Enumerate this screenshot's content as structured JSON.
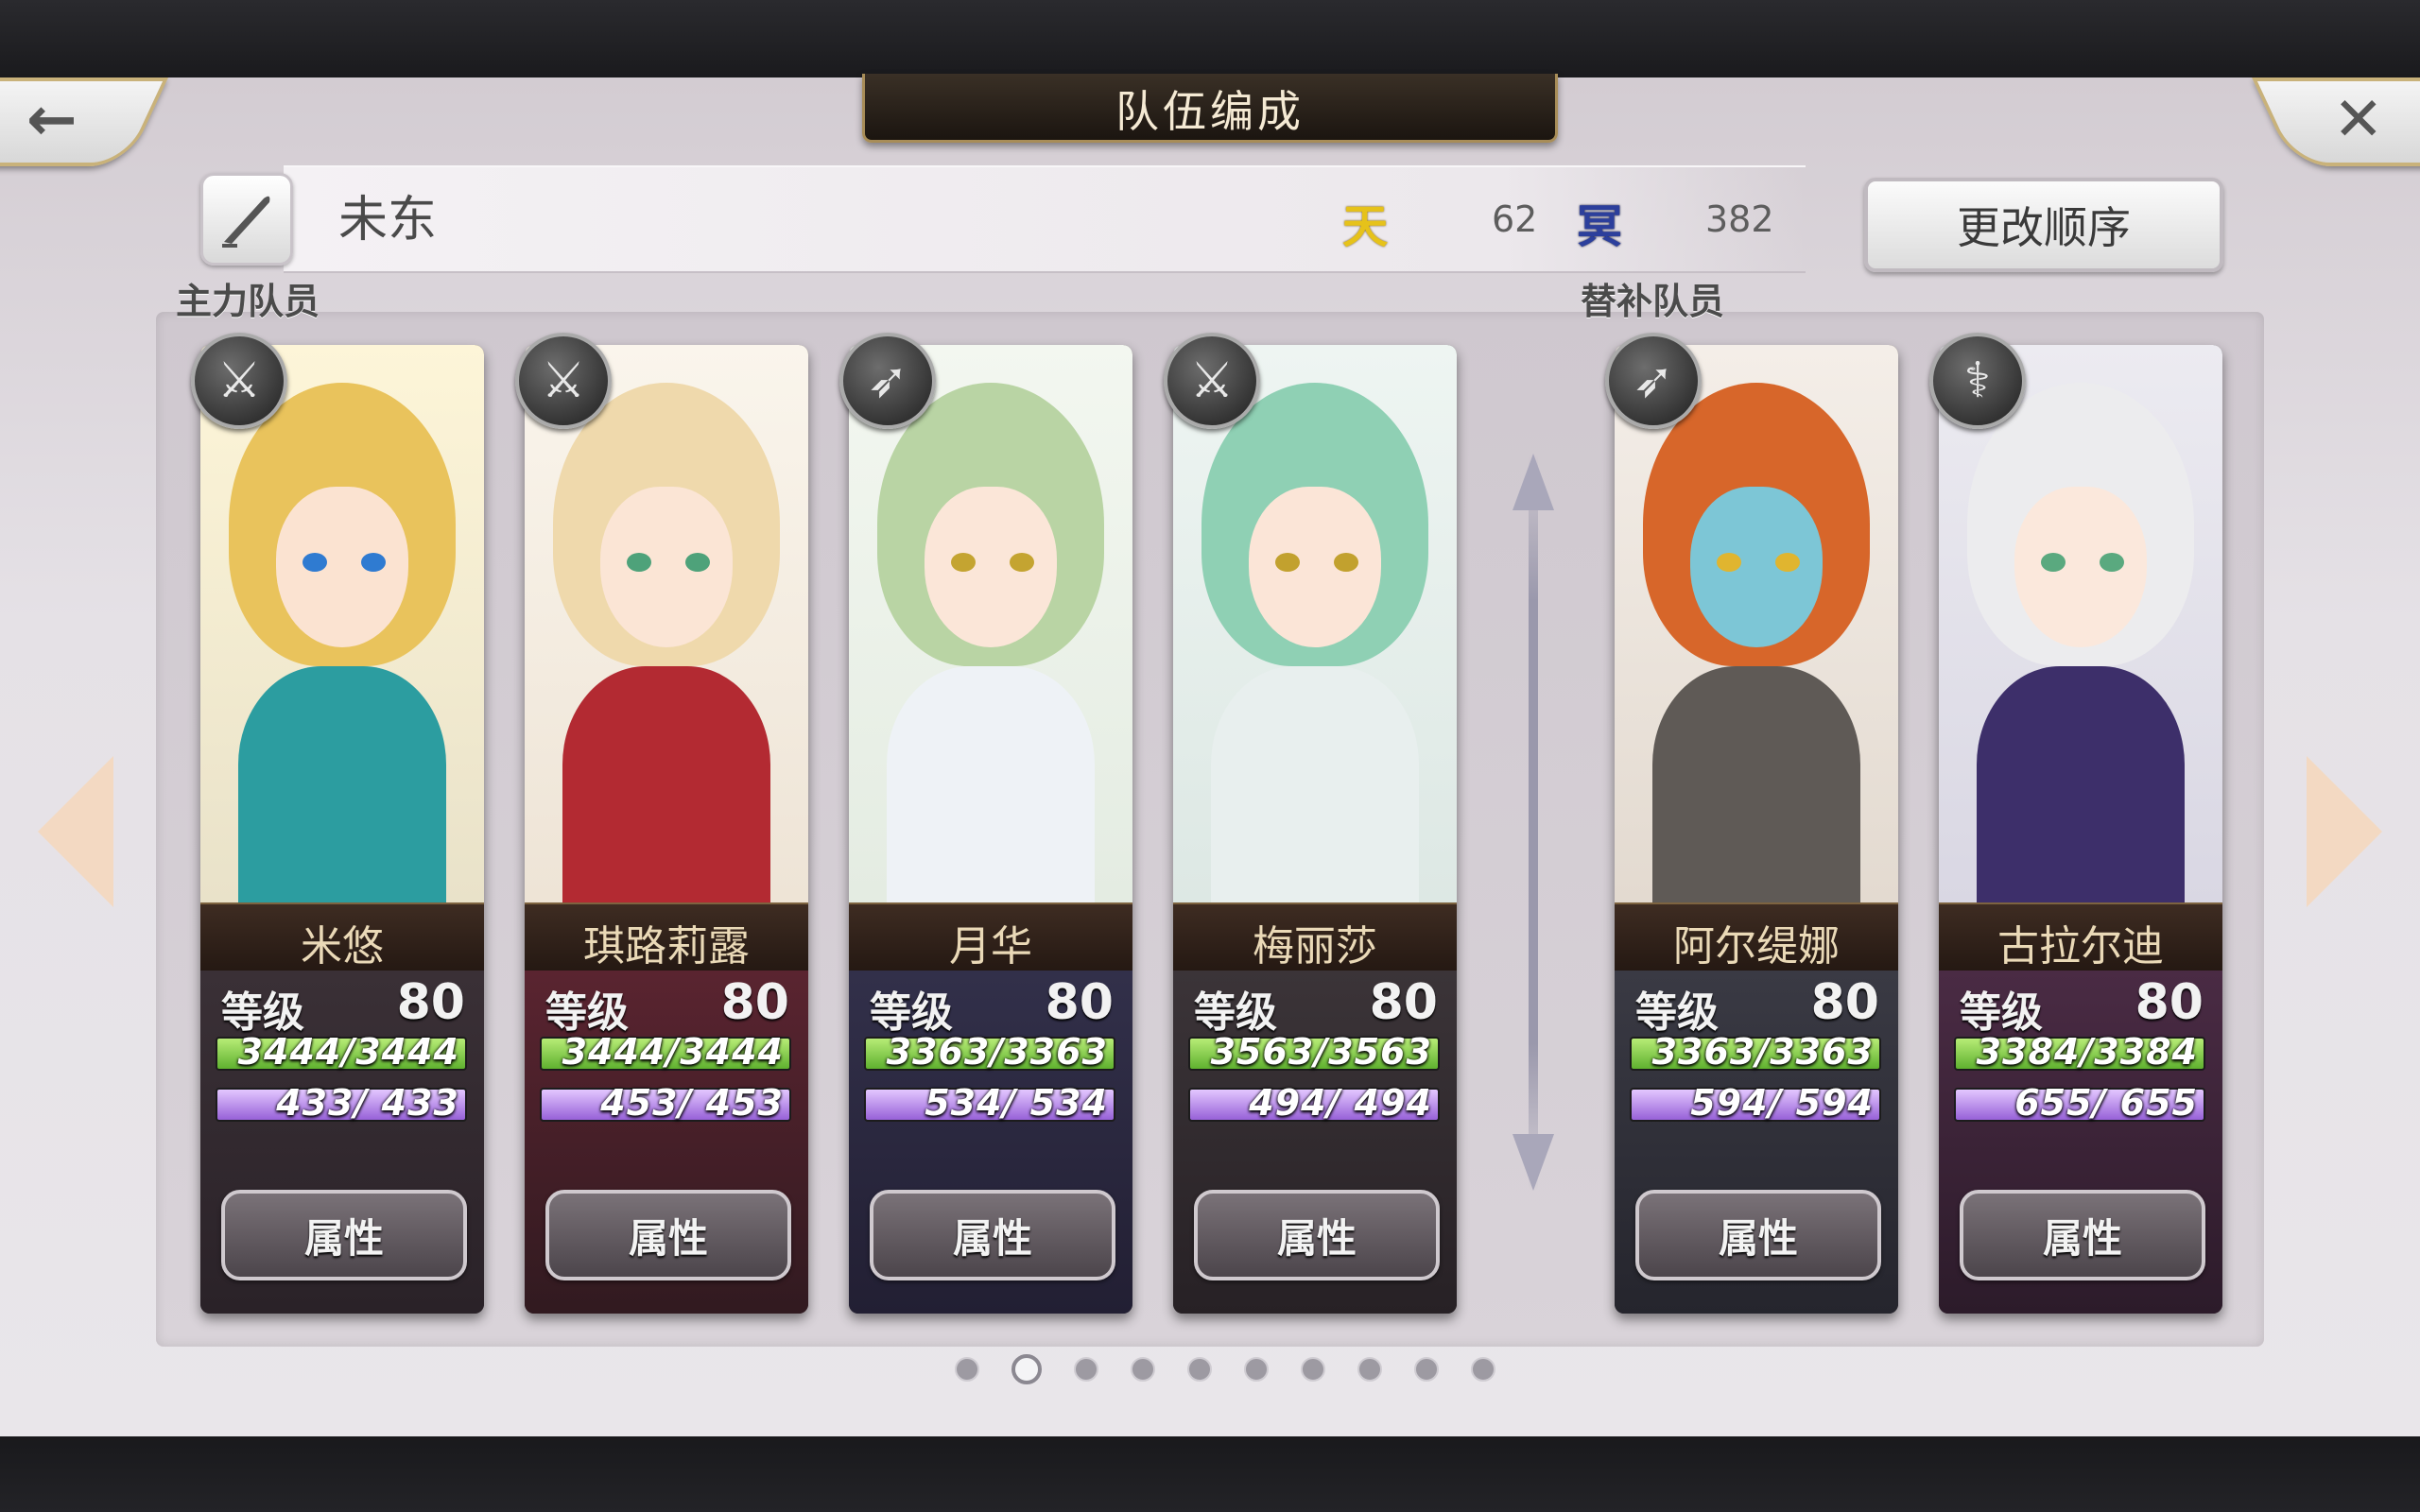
{
  "header": {
    "title": "队伍编成",
    "back_icon": "back-arrow-icon",
    "close_icon": "close-icon"
  },
  "team": {
    "name": "未东",
    "heaven_glyph": "天",
    "heaven_value": "62",
    "underworld_glyph": "冥",
    "underworld_value": "382",
    "reorder_label": "更改顺序"
  },
  "sections": {
    "main": "主力队员",
    "reserve": "替补队员"
  },
  "labels": {
    "level": "等级",
    "attr": "属性"
  },
  "main_members": [
    {
      "name": "米悠",
      "level": "80",
      "hp": "3444/3444",
      "mp": "433/ 433",
      "weapon": "sword"
    },
    {
      "name": "琪路莉露",
      "level": "80",
      "hp": "3444/3444",
      "mp": "453/ 453",
      "weapon": "sword"
    },
    {
      "name": "月华",
      "level": "80",
      "hp": "3363/3363",
      "mp": "534/ 534",
      "weapon": "bow"
    },
    {
      "name": "梅丽莎",
      "level": "80",
      "hp": "3563/3563",
      "mp": "494/ 494",
      "weapon": "sword"
    }
  ],
  "reserve_members": [
    {
      "name": "阿尔缇娜",
      "level": "80",
      "hp": "3363/3363",
      "mp": "594/ 594",
      "weapon": "bow"
    },
    {
      "name": "古拉尔迪",
      "level": "80",
      "hp": "3384/3384",
      "mp": "655/ 655",
      "weapon": "staff"
    }
  ],
  "pagination": {
    "total": 10,
    "active": 2
  },
  "colors": {
    "hp_bar": "#5fb12f",
    "mp_bar": "#9761d8",
    "heaven": "#e6c21a",
    "underworld": "#2c3f9c"
  }
}
